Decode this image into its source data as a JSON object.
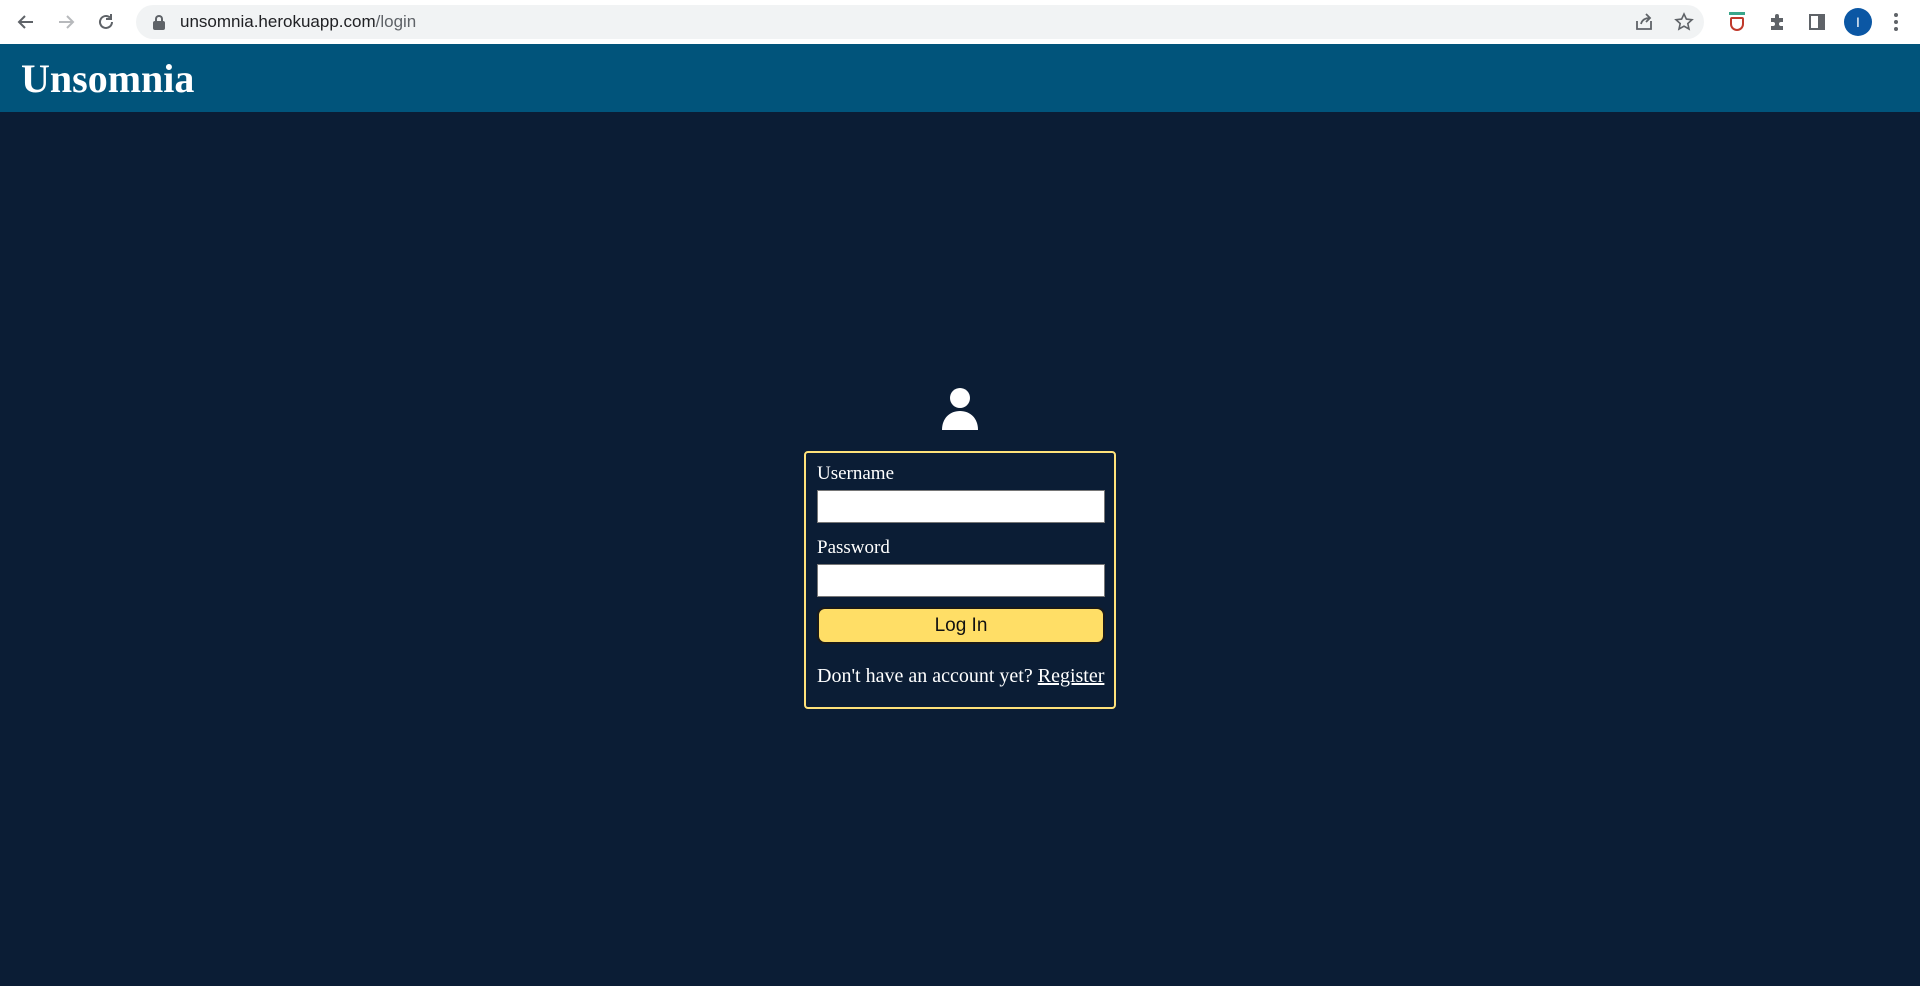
{
  "browser": {
    "url_host": "unsomnia.herokuapp.com",
    "url_path": "/login",
    "profile_initial": "I"
  },
  "header": {
    "title": "Unsomnia"
  },
  "login": {
    "username_label": "Username",
    "username_value": "",
    "password_label": "Password",
    "password_value": "",
    "submit_label": "Log In",
    "register_prompt": "Don't have an account yet?",
    "register_link": "Register"
  },
  "colors": {
    "header_bg": "#01547b",
    "page_bg": "#0b1d35",
    "accent_yellow": "#ffde66",
    "box_border": "#ffe27a"
  },
  "icons": {
    "back": "arrow-left-icon",
    "forward": "arrow-right-icon",
    "reload": "reload-icon",
    "lock": "lock-icon",
    "share": "share-icon",
    "bookmark": "star-icon",
    "extension": "shield-extension-icon",
    "extensions": "puzzle-icon",
    "side_panel": "side-panel-icon",
    "menu": "kebab-menu-icon",
    "user": "user-icon"
  }
}
